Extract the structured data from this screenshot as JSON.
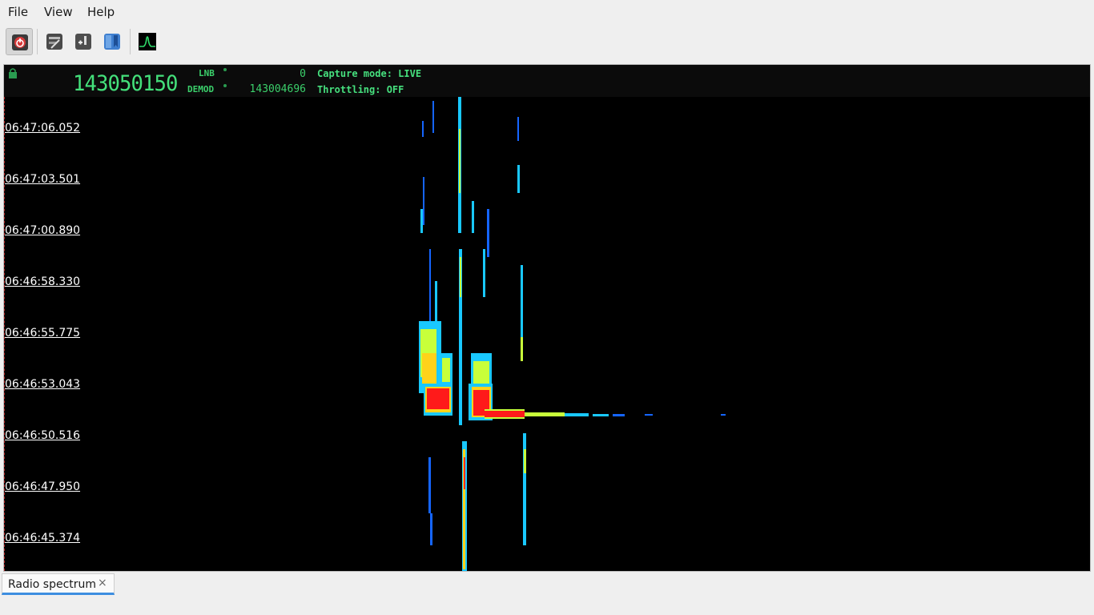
{
  "menu": {
    "file": "File",
    "view": "View",
    "help": "Help"
  },
  "toolbar": {
    "buttons": [
      "power-icon",
      "settings-icon",
      "import-icon",
      "bookmark-icon",
      "spectrum-icon"
    ]
  },
  "header": {
    "frequency": "143050150",
    "lnb_label": "LNB",
    "lnb_value": "0",
    "demod_label": "DEMOD",
    "demod_value": "143004696",
    "capture_mode": "Capture mode: LIVE",
    "throttling": "Throttling: OFF"
  },
  "waterfall": {
    "timestamps": [
      "06:47:06.052",
      "06:47:03.501",
      "06:47:00.890",
      "06:46:58.330",
      "06:46:55.775",
      "06:46:53.043",
      "06:46:50.516",
      "06:46:47.950",
      "06:46:45.374"
    ],
    "colors": {
      "background": "#000000",
      "low": "#0a3cff",
      "mid": "#19e6ff",
      "high": "#ffe619",
      "peak": "#ff1a1a"
    }
  },
  "tabs": [
    {
      "label": "Radio spectrum",
      "close": "×"
    }
  ]
}
